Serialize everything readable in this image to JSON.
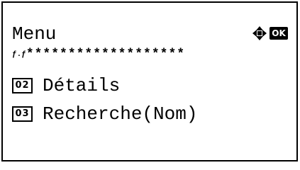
{
  "screen": {
    "title": "Menu",
    "nav_icon": "four-way-arrows-icon",
    "ok_label": "OK",
    "entry_bar": {
      "progress": "ƒ.ƒ",
      "stars": "*******************"
    },
    "items": [
      {
        "number": "02",
        "label": "Détails"
      },
      {
        "number": "03",
        "label": "Recherche(Nom)"
      }
    ]
  },
  "colors": {
    "foreground": "#000000",
    "background": "#ffffff"
  }
}
